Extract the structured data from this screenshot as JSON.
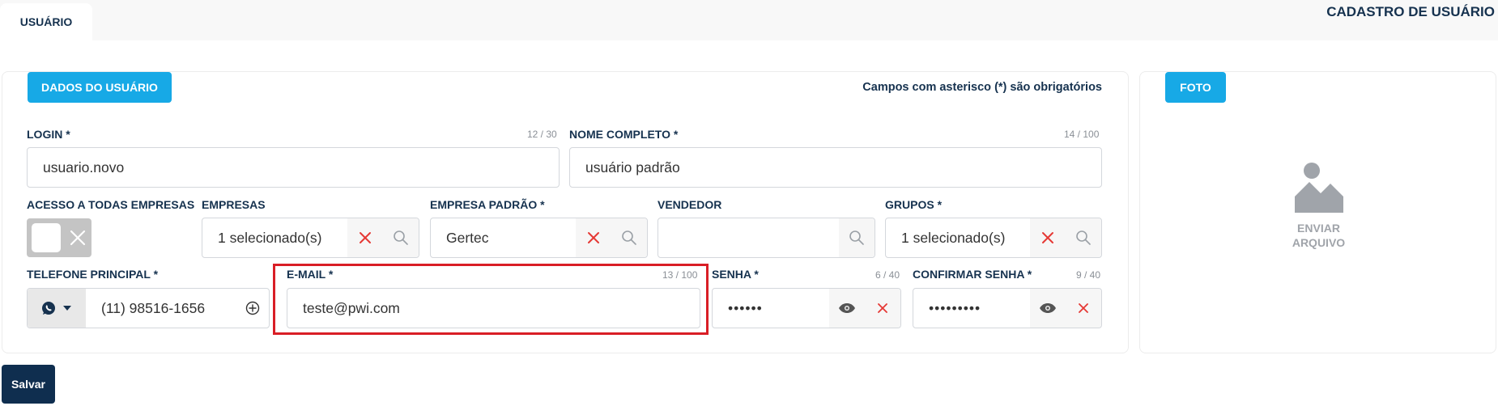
{
  "header": {
    "tab_label": "USUÁRIO",
    "page_title": "CADASTRO DE USUÁRIO"
  },
  "main_card": {
    "section_title": "DADOS DO USUÁRIO",
    "required_note": "Campos com asterisco (*) são obrigatórios"
  },
  "fields": {
    "login": {
      "label": "LOGIN *",
      "counter": "12 / 30",
      "value": "usuario.novo"
    },
    "nome": {
      "label": "NOME COMPLETO *",
      "counter": "14 / 100",
      "value": "usuário padrão"
    },
    "acesso": {
      "label": "ACESSO A TODAS EMPRESAS"
    },
    "empresas": {
      "label": "EMPRESAS",
      "value": "1 selecionado(s)"
    },
    "empresa_padrao": {
      "label": "EMPRESA PADRÃO *",
      "value": "Gertec"
    },
    "vendedor": {
      "label": "VENDEDOR",
      "value": ""
    },
    "grupos": {
      "label": "GRUPOS *",
      "value": "1 selecionado(s)"
    },
    "telefone": {
      "label": "TELEFONE PRINCIPAL *",
      "value": "(11) 98516-1656"
    },
    "email": {
      "label": "E-MAIL *",
      "counter": "13 / 100",
      "value": "teste@pwi.com"
    },
    "senha": {
      "label": "SENHA *",
      "counter": "6 / 40",
      "value": "••••••"
    },
    "confirmar_senha": {
      "label": "CONFIRMAR SENHA *",
      "counter": "9 / 40",
      "value": "•••••••••"
    }
  },
  "photo_card": {
    "section_title": "FOTO",
    "upload_line1": "ENVIAR",
    "upload_line2": "ARQUIVO"
  },
  "actions": {
    "save_label": "Salvar"
  },
  "colors": {
    "accent": "#17a9e6",
    "primary_dark": "#0f2e4f",
    "danger": "#e53935",
    "highlight": "#d91e26"
  },
  "icons": [
    "close-icon",
    "search-icon",
    "eye-icon",
    "whatsapp-icon",
    "caret-down-icon",
    "plus-circle-icon",
    "image-placeholder-icon"
  ]
}
